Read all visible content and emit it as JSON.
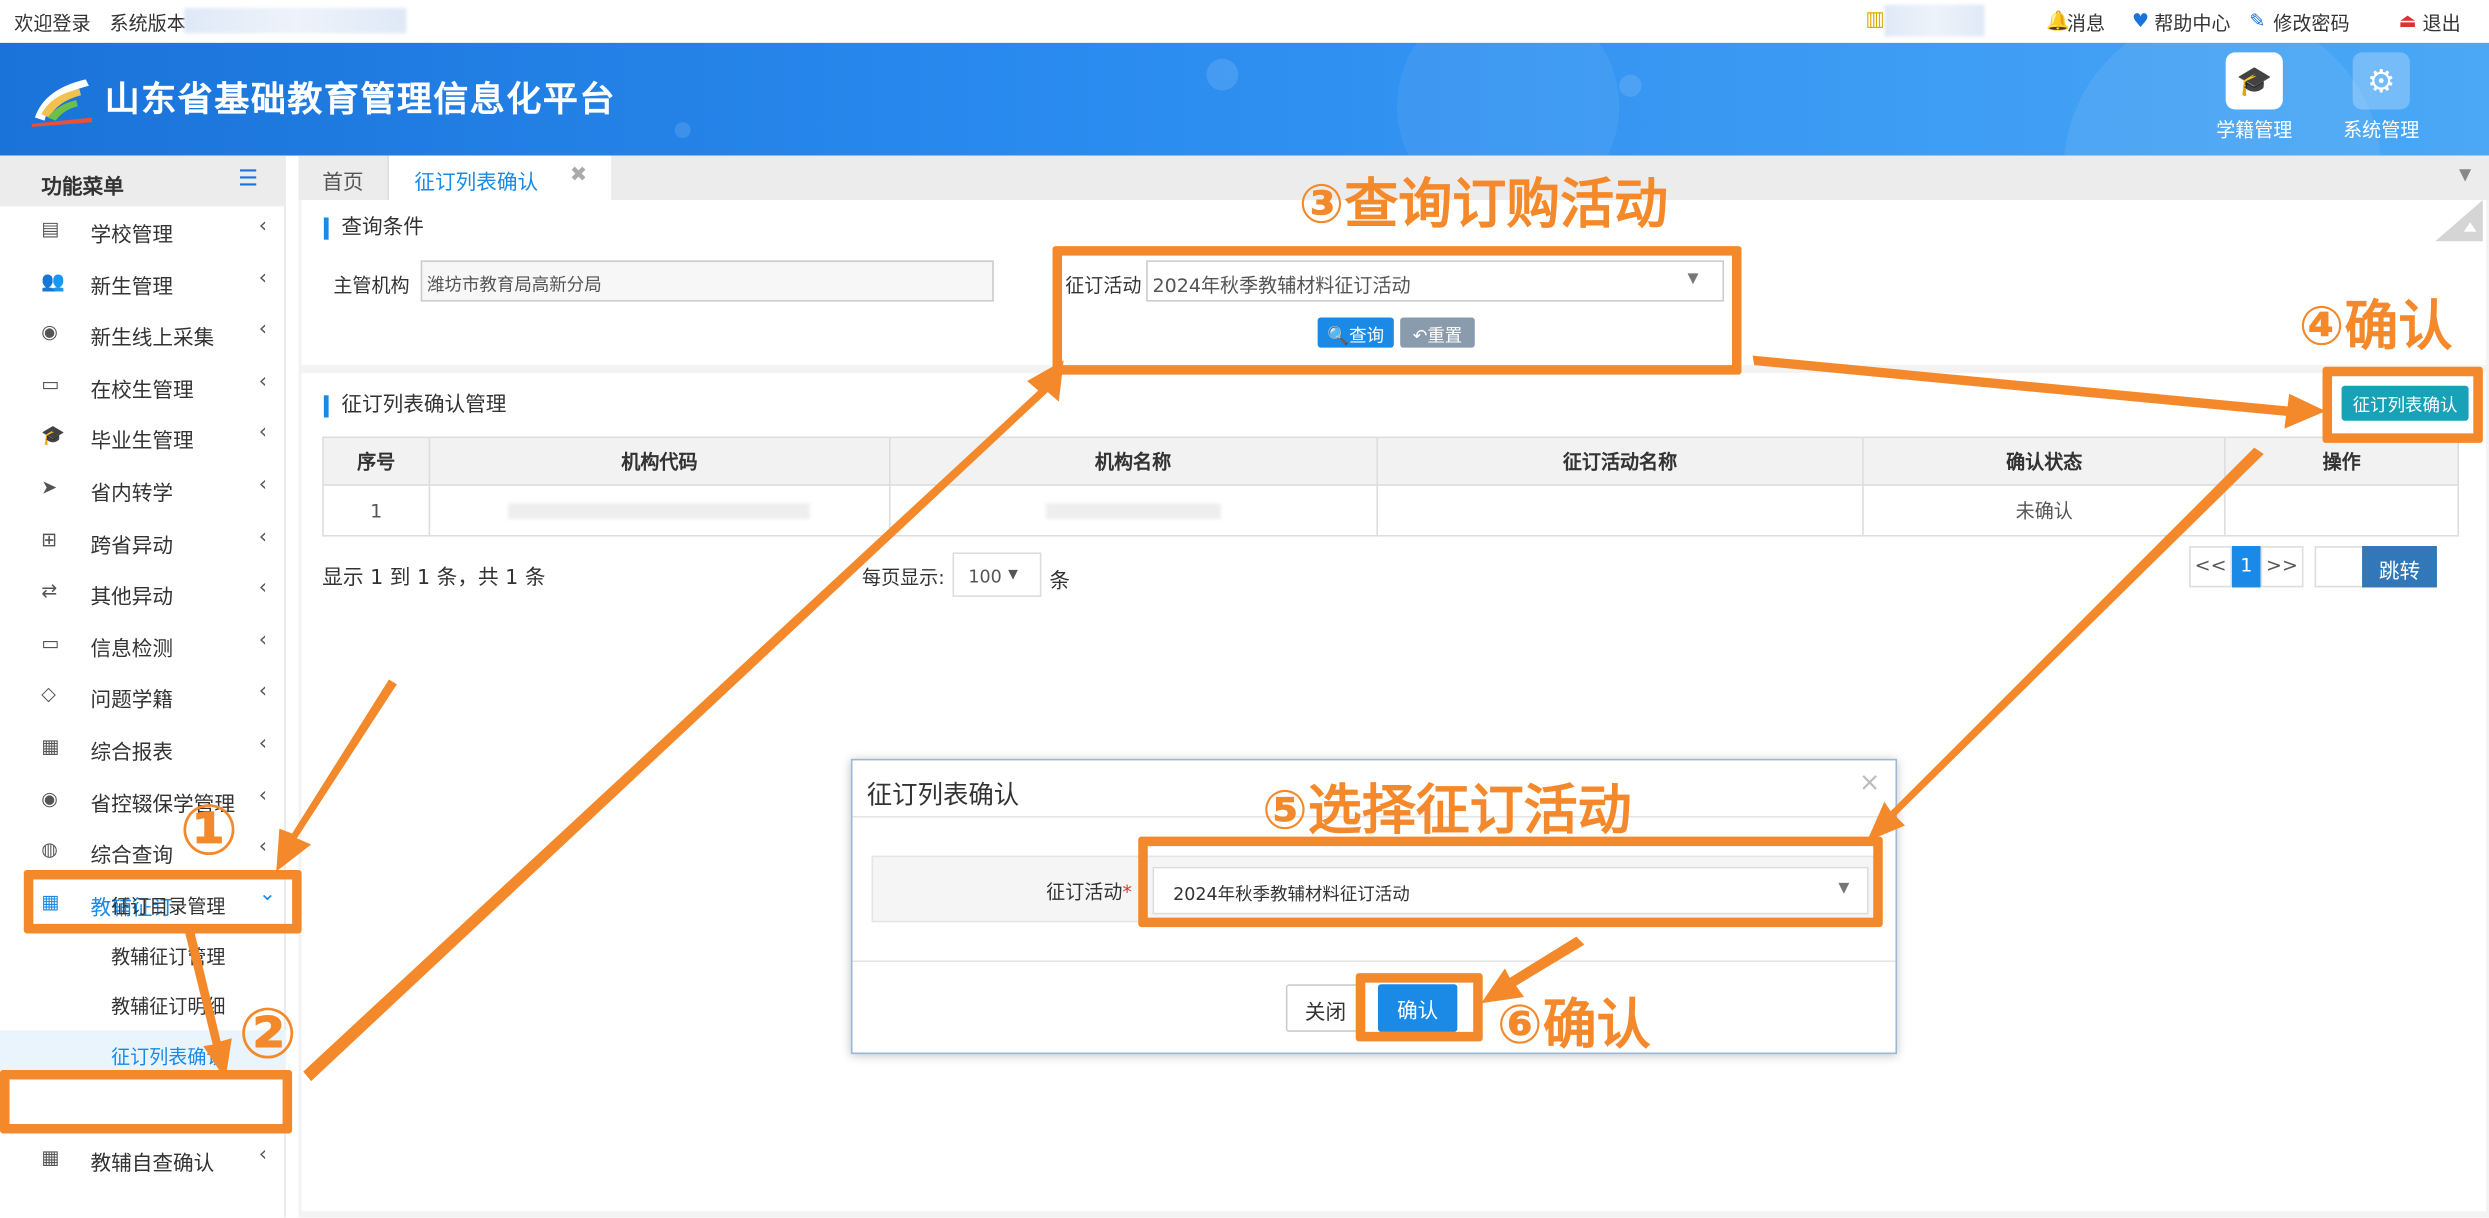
{
  "topbar": {
    "welcome": "欢迎登录",
    "version_label": "系统版本",
    "messages": "消息",
    "help": "帮助中心",
    "change_password": "修改密码",
    "logout": "退出"
  },
  "header": {
    "title": "山东省基础教育管理信息化平台",
    "buttons": [
      {
        "label": "学籍管理",
        "icon": "graduation-cap-icon"
      },
      {
        "label": "系统管理",
        "icon": "gear-icon"
      }
    ]
  },
  "sidebar": {
    "title": "功能菜单",
    "items": [
      {
        "label": "学校管理",
        "icon": "building-icon"
      },
      {
        "label": "新生管理",
        "icon": "users-icon"
      },
      {
        "label": "新生线上采集",
        "icon": "user-circle-icon"
      },
      {
        "label": "在校生管理",
        "icon": "id-card-icon"
      },
      {
        "label": "毕业生管理",
        "icon": "graduation-cap-icon"
      },
      {
        "label": "省内转学",
        "icon": "paper-plane-icon"
      },
      {
        "label": "跨省异动",
        "icon": "sitemap-icon"
      },
      {
        "label": "其他异动",
        "icon": "retweet-icon"
      },
      {
        "label": "信息检测",
        "icon": "id-card-icon"
      },
      {
        "label": "问题学籍",
        "icon": "code-icon"
      },
      {
        "label": "综合报表",
        "icon": "file-icon"
      },
      {
        "label": "省控辍保学管理",
        "icon": "user-circle-icon"
      },
      {
        "label": "综合查询",
        "icon": "compass-icon"
      },
      {
        "label": "教辅征订",
        "icon": "calendar-icon"
      }
    ],
    "sub_items": [
      "征订目录管理",
      "教辅征订管理",
      "教辅征订明细",
      "征订列表确认"
    ],
    "last_item": {
      "label": "教辅自查确认",
      "icon": "calendar-icon"
    }
  },
  "tabs": [
    {
      "label": "首页"
    },
    {
      "label": "征订列表确认"
    }
  ],
  "query": {
    "section_title": "查询条件",
    "org_label": "主管机构",
    "org_value": "潍坊市教育局高新分局",
    "activity_label": "征订活动",
    "activity_value": "2024年秋季教辅材料征订活动",
    "search_button": "查询",
    "reset_button": "重置"
  },
  "manage": {
    "section_title": "征订列表确认管理",
    "confirm_button": "征订列表确认",
    "columns": [
      "序号",
      "机构代码",
      "机构名称",
      "征订活动名称",
      "确认状态",
      "操作"
    ],
    "rows": [
      {
        "index": "1",
        "status": "未确认"
      }
    ],
    "summary": "显示 1 到 1 条，共 1 条",
    "page_size_label": "每页显示:",
    "page_size": "100",
    "page_size_unit": "条",
    "pager": {
      "prev": "<<",
      "current": "1",
      "next": ">>",
      "jump": "跳转"
    }
  },
  "modal": {
    "title": "征订列表确认",
    "field_label": "征订活动",
    "field_value": "2024年秋季教辅材料征订活动",
    "close_button": "关闭",
    "confirm_button": "确认"
  },
  "annotations": {
    "a1": "①",
    "a2": "②",
    "a3": "③查询订购活动",
    "a4": "④确认",
    "a5": "⑤选择征订活动",
    "a6": "⑥确认"
  },
  "colors": {
    "header_blue": "#1a73d9",
    "accent_blue": "#1a8ae6",
    "annotation_orange": "#f4892b",
    "teal_button": "#17a2b8"
  }
}
